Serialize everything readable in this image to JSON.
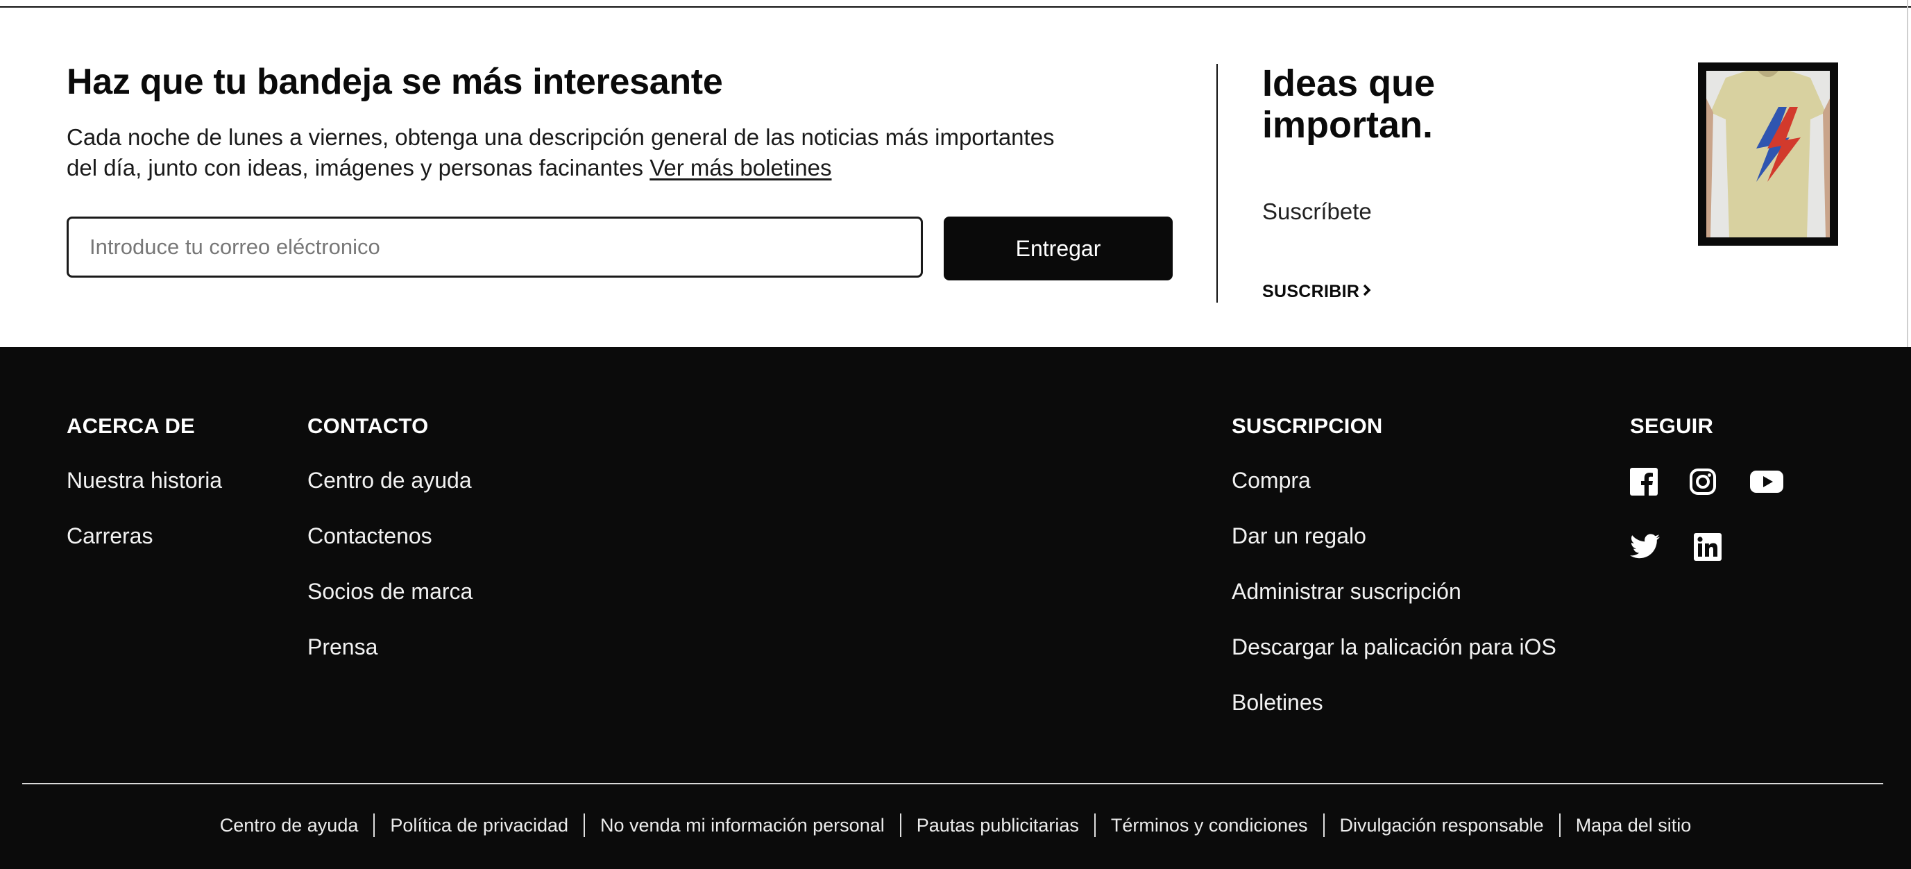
{
  "newsletter": {
    "title": "Haz que tu bandeja se más interesante",
    "description": "Cada noche de lunes a viernes, obtenga una descripción general de las noticias más importantes del día, junto con ideas, imágenes y personas facinantes ",
    "more_link": "Ver más boletines",
    "email_placeholder": "Introduce tu correo eléctronico",
    "submit_label": "Entregar"
  },
  "promo": {
    "title": "Ideas que importan.",
    "subtitle": "Suscríbete",
    "cta": "SUSCRIBIR",
    "image_alt": "Camiseta beige con rayo rojo y azul"
  },
  "footer": {
    "about": {
      "heading": "ACERCA DE",
      "links": [
        "Nuestra historia",
        "Carreras"
      ]
    },
    "contact": {
      "heading": "CONTACTO",
      "links": [
        "Centro de ayuda",
        "Contactenos",
        "Socios de marca",
        "Prensa"
      ]
    },
    "subscription": {
      "heading": "SUSCRIPCION",
      "links": [
        "Compra",
        "Dar un regalo",
        "Administrar suscripción",
        "Descargar la palicación para iOS",
        "Boletines"
      ]
    },
    "follow": {
      "heading": "SEGUIR",
      "icons": [
        "facebook-icon",
        "instagram-icon",
        "youtube-icon",
        "twitter-icon",
        "linkedin-icon"
      ]
    },
    "bottom_links": [
      "Centro de ayuda",
      "Política de privacidad",
      "No venda mi información personal",
      "Pautas publicitarias",
      "Términos y condiciones",
      "Divulgación responsable",
      "Mapa del sitio"
    ]
  },
  "colors": {
    "footer_bg": "#0b0b0b",
    "button_bg": "#0a0a0a",
    "shirt": "#d8d1a0",
    "bolt_red": "#d23a2c",
    "bolt_blue": "#2f55b0"
  }
}
